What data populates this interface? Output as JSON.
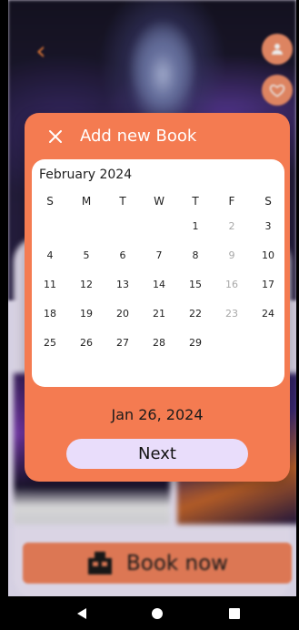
{
  "dialog": {
    "title": "Add new Book",
    "close_icon": "close-icon",
    "calendar": {
      "month_label": "February 2024",
      "weekdays": [
        "S",
        "M",
        "T",
        "W",
        "T",
        "F",
        "S"
      ],
      "weeks": [
        [
          "",
          "",
          "",
          "",
          "1",
          "2",
          "3"
        ],
        [
          "4",
          "5",
          "6",
          "7",
          "8",
          "9",
          "10"
        ],
        [
          "11",
          "12",
          "13",
          "14",
          "15",
          "16",
          "17"
        ],
        [
          "18",
          "19",
          "20",
          "21",
          "22",
          "23",
          "24"
        ],
        [
          "25",
          "26",
          "27",
          "28",
          "29",
          "",
          ""
        ]
      ],
      "disabled_days": [
        "2",
        "9",
        "16",
        "23"
      ]
    },
    "selected_date": "Jan 26, 2024",
    "next_label": "Next"
  },
  "background": {
    "back_icon": "chevron-left-icon",
    "profile_icon": "person-icon",
    "favorite_icon": "heart-icon",
    "book_now_label": "Book now",
    "book_now_icon": "ticket-booth-icon"
  },
  "navbar": {
    "back_icon": "nav-back-icon",
    "home_icon": "nav-home-icon",
    "recents_icon": "nav-recents-icon"
  },
  "colors": {
    "accent": "#f47b51",
    "button_secondary": "#e9ddfb",
    "disabled_text": "#a8a8a8"
  }
}
